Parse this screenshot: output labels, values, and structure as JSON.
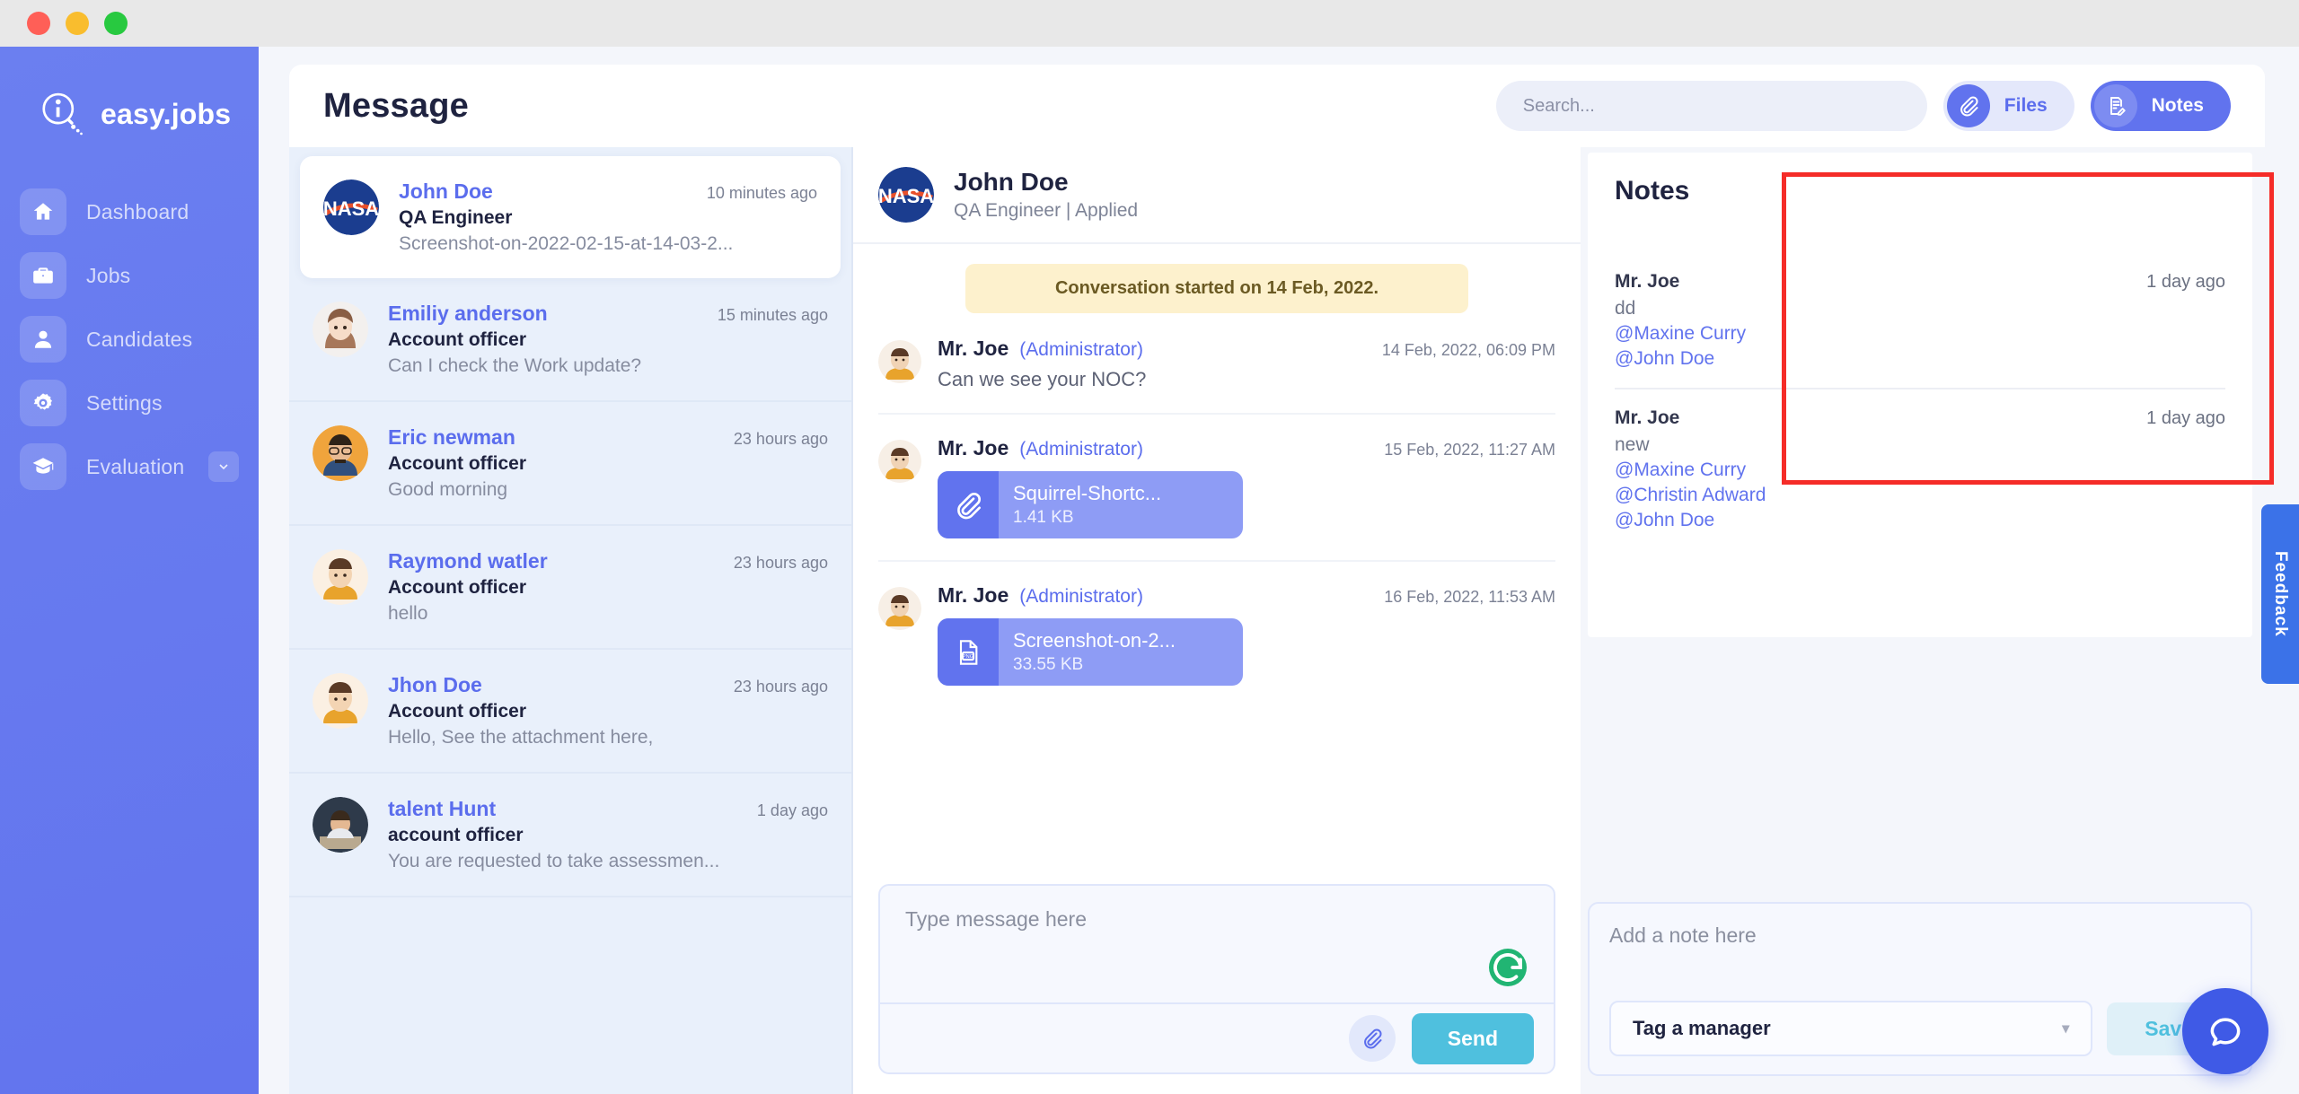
{
  "window": {
    "dots": [
      "close",
      "minimize",
      "maximize"
    ]
  },
  "sidebar": {
    "brand": "easy.jobs",
    "items": [
      {
        "label": "Dashboard",
        "icon": "home-icon"
      },
      {
        "label": "Jobs",
        "icon": "briefcase-icon"
      },
      {
        "label": "Candidates",
        "icon": "user-icon"
      },
      {
        "label": "Settings",
        "icon": "gear-icon"
      },
      {
        "label": "Evaluation",
        "icon": "graduation-cap-icon",
        "chevron": true
      }
    ]
  },
  "header": {
    "title": "Message",
    "search_placeholder": "Search...",
    "files_label": "Files",
    "notes_label": "Notes"
  },
  "conversations": [
    {
      "name": "John Doe",
      "time": "10 minutes ago",
      "role": "QA Engineer",
      "preview": "Screenshot-on-2022-02-15-at-14-03-2...",
      "avatar": "nasa-logo",
      "active": true
    },
    {
      "name": "Emiliy anderson",
      "time": "15 minutes ago",
      "role": "Account officer",
      "preview": "Can I check the Work update?",
      "avatar": "woman-avatar",
      "active": false
    },
    {
      "name": "Eric newman",
      "time": "23 hours ago",
      "role": "Account officer",
      "preview": "Good morning",
      "avatar": "bearded-man-avatar",
      "active": false
    },
    {
      "name": "Raymond watler",
      "time": "23 hours ago",
      "role": "Account officer",
      "preview": "hello",
      "avatar": "man-avatar",
      "active": false
    },
    {
      "name": "Jhon Doe",
      "time": "23 hours ago",
      "role": "Account officer",
      "preview": "Hello, See the attachment here,",
      "avatar": "man-avatar",
      "active": false
    },
    {
      "name": "talent Hunt",
      "time": "1 day ago",
      "role": "account officer",
      "preview": "You are requested to take assessmen...",
      "avatar": "photo-avatar",
      "active": false
    }
  ],
  "thread": {
    "name": "John Doe",
    "subtitle": "QA Engineer | Applied",
    "banner": "Conversation started on 14 Feb, 2022.",
    "messages": [
      {
        "author": "Mr. Joe",
        "role": "(Administrator)",
        "time": "14 Feb, 2022, 06:09 PM",
        "text": "Can we see your NOC?"
      },
      {
        "author": "Mr. Joe",
        "role": "(Administrator)",
        "time": "15 Feb, 2022, 11:27 AM",
        "attachment": {
          "name": "Squirrel-Shortc...",
          "size": "1.41 KB",
          "icon": "paperclip-icon"
        }
      },
      {
        "author": "Mr. Joe",
        "role": "(Administrator)",
        "time": "16 Feb, 2022, 11:53 AM",
        "attachment": {
          "name": "Screenshot-on-2...",
          "size": "33.55 KB",
          "icon": "png-file-icon"
        }
      }
    ],
    "composer_placeholder": "Type message here",
    "send_label": "Send"
  },
  "notes_panel": {
    "title": "Notes",
    "notes": [
      {
        "author": "Mr. Joe",
        "time": "1 day ago",
        "text": "dd",
        "tags": [
          "@Maxine Curry",
          "@John Doe"
        ]
      },
      {
        "author": "Mr. Joe",
        "time": "1 day ago",
        "text": "new",
        "tags": [
          "@Maxine Curry",
          "@Christin Adward",
          "@John Doe"
        ]
      }
    ],
    "note_placeholder": "Add a note here",
    "tag_select": "Tag a manager",
    "save_label": "Save"
  },
  "feedback_tab": "Feedback",
  "colors": {
    "sidebar": "#6478ef",
    "accent": "#6173ee",
    "send": "#4fc0de",
    "highlight": "#f52c28",
    "banner": "#fdf1cd"
  }
}
